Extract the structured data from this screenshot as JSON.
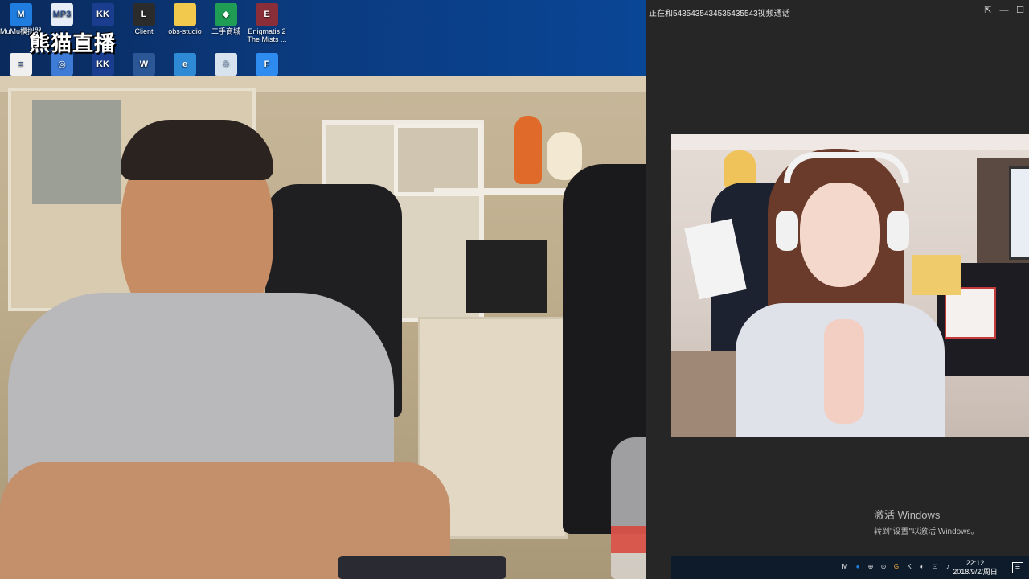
{
  "desktop": {
    "icons_row1": [
      {
        "label": "MuMu模拟器",
        "icon": "mumu-icon",
        "color": "#1f7de0",
        "glyph": "M"
      },
      {
        "label": "",
        "icon": "mp3-file-icon",
        "color": "#e8eef8",
        "glyph": "MP3"
      },
      {
        "label": "",
        "icon": "kk-app-icon",
        "color": "#1a3d8f",
        "glyph": "KK"
      },
      {
        "label": "Client",
        "icon": "lol-client-icon",
        "color": "#2b2b2b",
        "glyph": "L"
      },
      {
        "label": "obs-studio",
        "icon": "folder-icon",
        "color": "#f2c94c",
        "glyph": ""
      },
      {
        "label": "二手商城",
        "icon": "shop-icon",
        "color": "#1f9d55",
        "glyph": "◆"
      },
      {
        "label": "Enigmatis 2 The Mists ...",
        "icon": "game-icon",
        "color": "#8a2f3a",
        "glyph": "E"
      }
    ],
    "icons_row2": [
      {
        "label": "",
        "icon": "document-icon",
        "color": "#f0f0f0",
        "glyph": "≡"
      },
      {
        "label": "",
        "icon": "network-icon",
        "color": "#3d7bd6",
        "glyph": "◎"
      },
      {
        "label": "",
        "icon": "kk-app-icon",
        "color": "#1a3d8f",
        "glyph": "KK"
      },
      {
        "label": "",
        "icon": "word-icon",
        "color": "#2b5797",
        "glyph": "W"
      },
      {
        "label": "",
        "icon": "edge-icon",
        "color": "#2f8ad6",
        "glyph": "e"
      },
      {
        "label": "",
        "icon": "recycle-bin-icon",
        "color": "#d7e3ef",
        "glyph": "♲"
      },
      {
        "label": "",
        "icon": "app-f-icon",
        "color": "#2e8bf0",
        "glyph": "F"
      }
    ],
    "watermark": "熊猫直播"
  },
  "call": {
    "title": "正在和5435435434535435543视频通话",
    "pin_icon": "pin-icon",
    "minimize_icon": "minimize-icon",
    "maximize_icon": "maximize-icon"
  },
  "activation": {
    "title": "激活 Windows",
    "subtitle": "转到\"设置\"以激活 Windows。"
  },
  "taskbar": {
    "time": "22:12",
    "date": "2018/9/2/周日",
    "tray_icons": [
      "M",
      "●",
      "⊕",
      "⊙",
      "G",
      "K",
      "◐",
      "⊡",
      "♪"
    ]
  }
}
